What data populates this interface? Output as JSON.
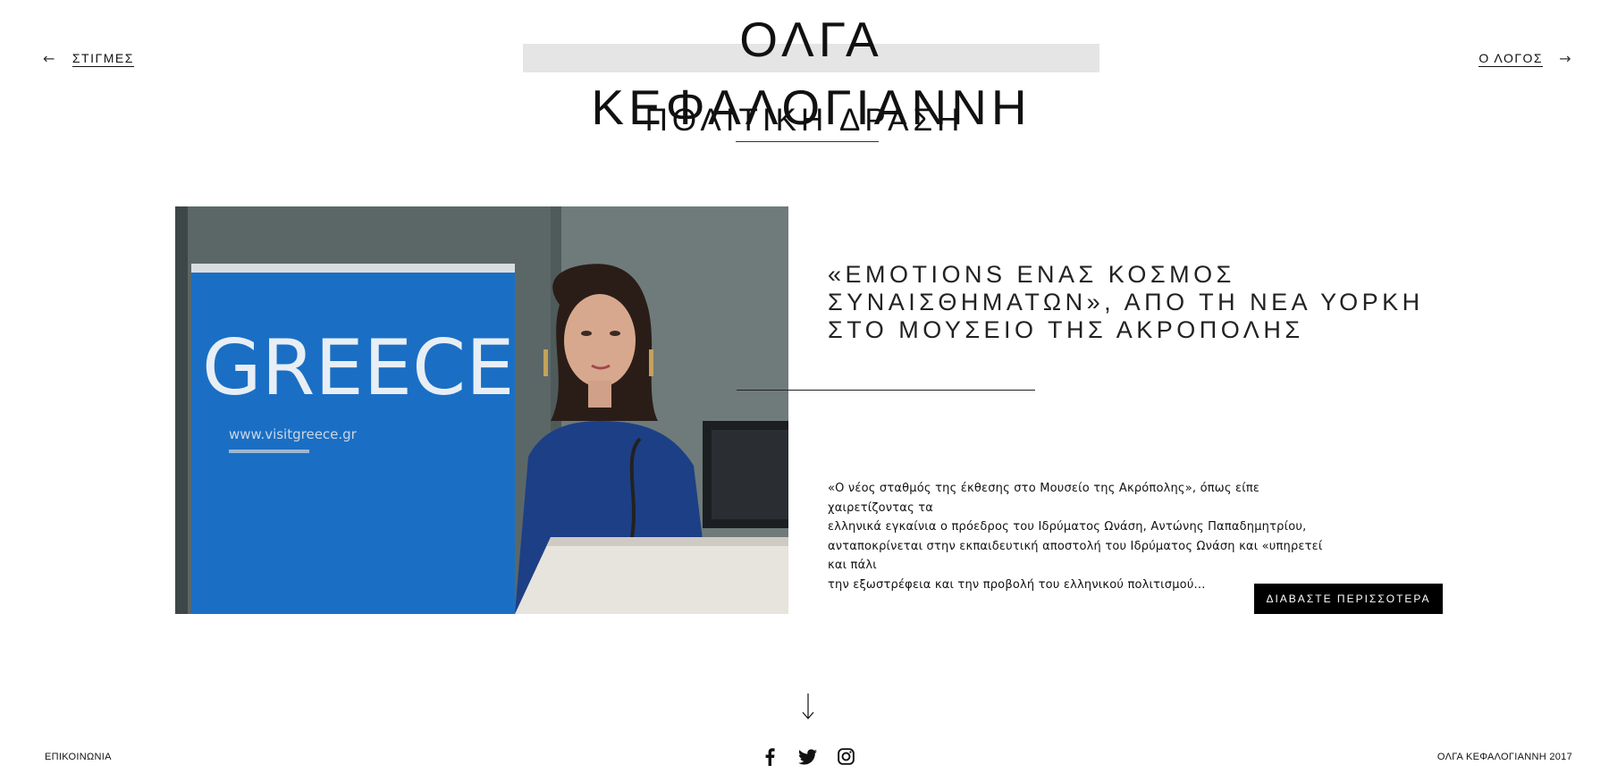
{
  "header": {
    "site_title": "ΟΛΓΑ ΚΕΦΑΛΟΓΙΑΝΝΗ",
    "prev_arrow": "←",
    "prev_label": "ΣΤΙΓΜΕΣ",
    "next_label": "Ο ΛΟΓΟΣ",
    "next_arrow": "→"
  },
  "section": {
    "title": "ΠΟΛΙΤΙΚΗ ΔΡΑΣΗ"
  },
  "article": {
    "image_banner_text": "GREECE",
    "image_banner_url": "www.visitgreece.gr",
    "title_lines": [
      "«EMOTIONS ΕΝΑΣ ΚΟΣΜΟΣ",
      "ΣΥΝΑΙΣΘΗΜΑΤΩΝ», ΑΠΟ ΤΗ ΝΕΑ ΥΟΡΚΗ",
      "ΣΤΟ ΜΟΥΣΕΙΟ ΤΗΣ ΑΚΡΟΠΟΛΗΣ"
    ],
    "excerpt_lines": [
      "«Ο νέος σταθμός της έκθεσης στο Μουσείο της Ακρόπολης», όπως είπε χαιρετίζοντας τα",
      "ελληνικά εγκαίνια ο πρόεδρος του Ιδρύματος Ωνάση, Αντώνης Παπαδημητρίου,",
      "ανταποκρίνεται στην εκπαιδευτική αποστολή του Ιδρύματος Ωνάση και «υπηρετεί και πάλι",
      "την εξωστρέφεια και την προβολή του ελληνικού πολιτισμού..."
    ],
    "read_more_label": "ΔΙΑΒΑΣΤΕ ΠΕΡΙΣΣΟΤΕΡΑ"
  },
  "scroll_arrow": "↓",
  "footer": {
    "contact_label": "ΕΠΙΚΟΙΝΩΝΙΑ",
    "copyright": "ΟΛΓΑ ΚΕΦΑΛΟΓΙΑΝΝΗ 2017",
    "socials": [
      "facebook-icon",
      "twitter-icon",
      "instagram-icon"
    ]
  },
  "colors": {
    "title_band": "#e5e5e5",
    "button_bg": "#000000",
    "banner_blue": "#1a6fc4"
  }
}
